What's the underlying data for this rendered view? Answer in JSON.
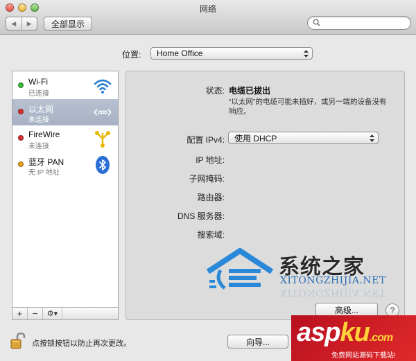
{
  "window": {
    "title": "网络"
  },
  "toolbar": {
    "back_glyph": "◀",
    "forward_glyph": "▶",
    "show_all_label": "全部显示",
    "search_placeholder": ""
  },
  "location": {
    "label": "位置:",
    "value": "Home Office"
  },
  "services": [
    {
      "name": "Wi-Fi",
      "status": "已连接",
      "status_color": "#3dbb3d",
      "icon": "wifi-icon"
    },
    {
      "name": "以太网",
      "status": "未连接",
      "status_color": "#d93030",
      "icon": "ethernet-icon",
      "selected": true
    },
    {
      "name": "FireWire",
      "status": "未连接",
      "status_color": "#d93030",
      "icon": "firewire-icon"
    },
    {
      "name": "蓝牙 PAN",
      "status": "无 IP 地址",
      "status_color": "#e8a020",
      "icon": "bluetooth-icon"
    }
  ],
  "sidebar_buttons": {
    "add": "+",
    "remove": "−",
    "action": "⚙▾"
  },
  "detail": {
    "status_label": "状态:",
    "status_value": "电缆已拔出",
    "status_description": "“以太网”的电缆可能未插好，或另一端的设备没有响应。",
    "ipv4_label": "配置 IPv4:",
    "ipv4_value": "使用 DHCP",
    "ip_label": "IP 地址:",
    "subnet_label": "子网掩码:",
    "router_label": "路由器:",
    "dns_label": "DNS 服务器:",
    "search_domains_label": "搜索域:",
    "advanced_button": "高级...",
    "help_button": "?"
  },
  "footer": {
    "lock_text": "点按锁按钮以防止再次更改。",
    "assist_button": "向导..."
  },
  "watermark": {
    "title": "系统之家",
    "url": "XITONGZHIJIA.NET",
    "aspku_big_a": "asp",
    "aspku_big_b": "ku",
    "aspku_dot": ".com",
    "aspku_small": "免费网站源码下载站!"
  },
  "colors": {
    "accent_selection": "#a7b1c3",
    "wifi_blue": "#2a7fd4"
  }
}
